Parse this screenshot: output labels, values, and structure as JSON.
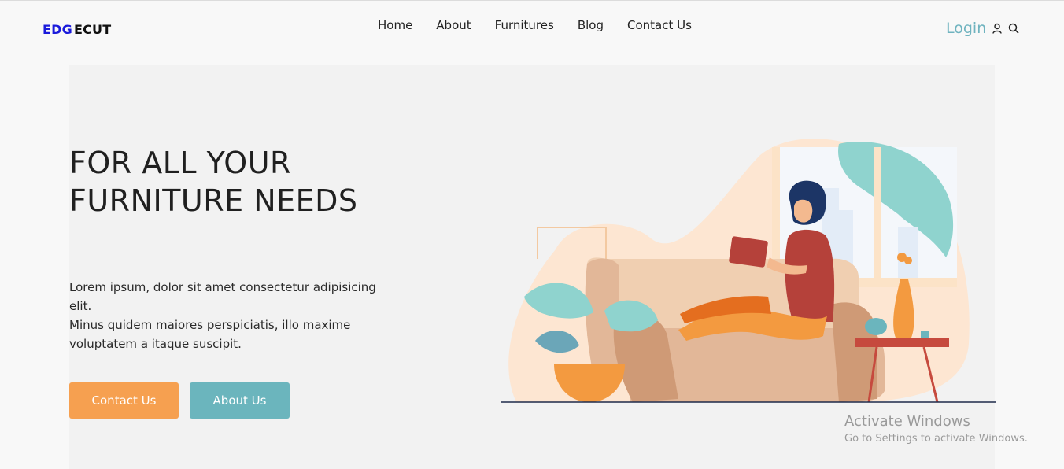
{
  "logo": {
    "part1": "EDG",
    "part2": "ECUT"
  },
  "nav": {
    "links": [
      "Home",
      "About",
      "Furnitures",
      "Blog",
      "Contact Us"
    ],
    "login": "Login",
    "icons": [
      "user-icon",
      "search-icon"
    ]
  },
  "hero": {
    "headline": "FOR ALL YOUR FURNITURE NEEDS",
    "description_line1": "Lorem ipsum, dolor sit amet consectetur adipisicing elit.",
    "description_line2": "Minus quidem maiores perspiciatis, illo maxime voluptatem a itaque suscipit.",
    "contact_button": "Contact Us",
    "about_button": "About Us"
  },
  "watermark": {
    "title": "Activate Windows",
    "subtitle": "Go to Settings to activate Windows."
  },
  "colors": {
    "logo_accent": "#1a1adb",
    "login": "#6fb3bf",
    "contact_button": "#f6a050",
    "about_button": "#6bb5bd",
    "hero_bg": "#f2f2f2"
  }
}
